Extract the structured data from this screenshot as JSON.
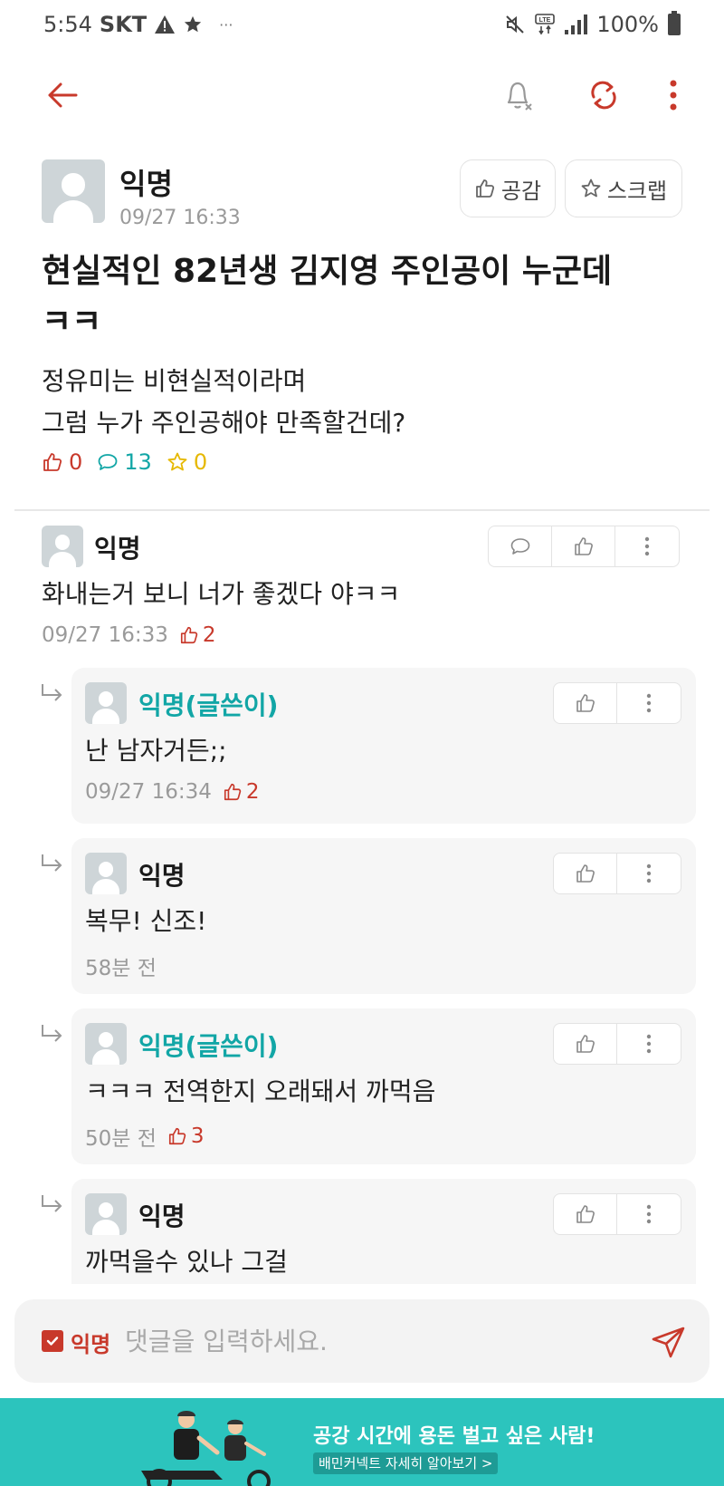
{
  "status_bar": {
    "time": "5:54",
    "carrier": "SKT",
    "more": "···",
    "battery": "100%"
  },
  "post": {
    "author": "익명",
    "time": "09/27 16:33",
    "empathy_label": "공감",
    "scrap_label": "스크랩",
    "title_line1": "현실적인 82년생 김지영 주인공이 누군데",
    "title_line2": "ㅋㅋ",
    "body_line1": "정유미는 비현실적이라며",
    "body_line2": "그럼 누가 주인공해야 만족할건데?",
    "likes": "0",
    "comments": "13",
    "scraps": "0"
  },
  "comments": [
    {
      "author": "익명",
      "text": "화내는거 보니 너가 좋겠다 야ㅋㅋ",
      "time": "09/27 16:33",
      "likes": "2"
    }
  ],
  "replies": [
    {
      "author": "익명(글쓴이)",
      "text": "난 남자거든;;",
      "time": "09/27 16:34",
      "likes": "2"
    },
    {
      "author": "익명",
      "text": "복무! 신조!",
      "time": "58분 전"
    },
    {
      "author": "익명(글쓴이)",
      "text": "ㅋㅋㅋ 전역한지 오래돼서 까먹음",
      "time": "50분 전",
      "likes": "3"
    },
    {
      "author": "익명",
      "text": "까먹을수 있나 그걸"
    }
  ],
  "input": {
    "anon_label": "익명",
    "placeholder": "댓글을 입력하세요."
  },
  "banner": {
    "title": "공강 시간에 용돈 벌고 싶은 사람!",
    "cta": "배민커넥트 자세히 알아보기 >"
  },
  "colors": {
    "accent_red": "#c8392b",
    "writer_teal": "#12a6a6",
    "banner_teal": "#2cc4bd",
    "scrap_yellow": "#e6b800",
    "comment_teal": "#12a6a6"
  },
  "icons": [
    "back-arrow-icon",
    "bell-off-icon",
    "refresh-icon",
    "more-vertical-icon",
    "thumbs-up-icon",
    "star-icon",
    "speech-bubble-icon",
    "reply-arrow-icon",
    "send-icon"
  ]
}
